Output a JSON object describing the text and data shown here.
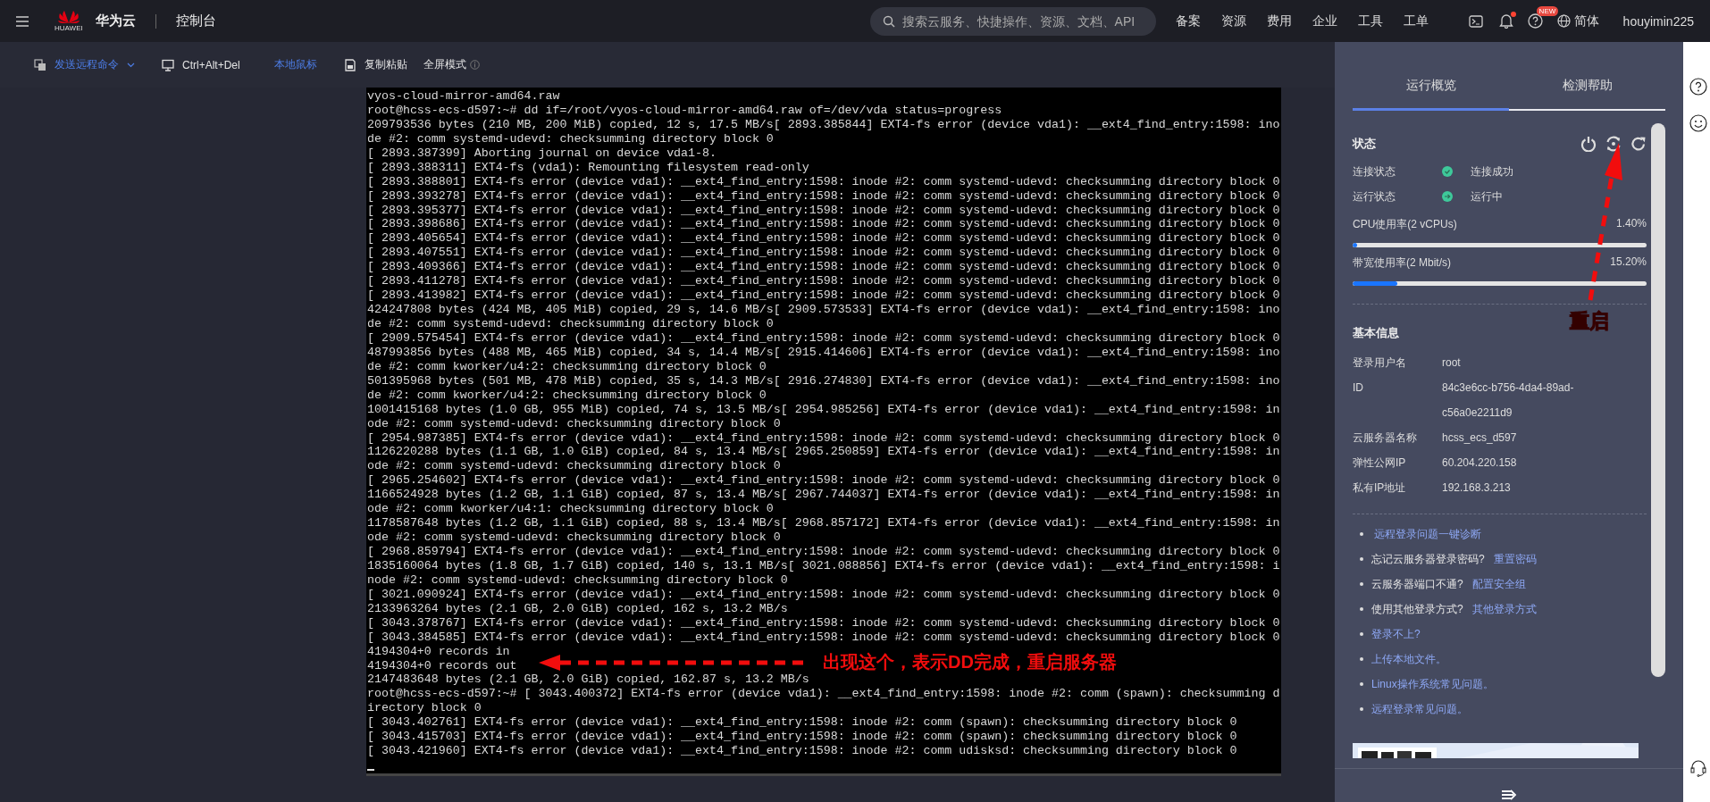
{
  "header": {
    "logo_text": "HUAWEI",
    "brand": "华为云",
    "console": "控制台",
    "search": {
      "placeholder": "搜索云服务、快捷操作、资源、文档、API"
    },
    "nav": [
      "备案",
      "资源",
      "费用",
      "企业",
      "工具",
      "工单"
    ],
    "bell_dot": true,
    "help_badge": "NEW",
    "language": "简体",
    "user": "houyimin225"
  },
  "toolbar": [
    {
      "label": "发送远程命令",
      "highlighted": true,
      "dropdown": true
    },
    {
      "label": "Ctrl+Alt+Del",
      "highlighted": false,
      "dropdown": false
    },
    {
      "label": "本地鼠标",
      "highlighted": true,
      "dropdown": false
    },
    {
      "label": "复制粘贴",
      "highlighted": false,
      "dropdown": false
    },
    {
      "label": "全屏模式",
      "highlighted": false,
      "dropdown": false
    }
  ],
  "terminal": {
    "lines": [
      "vyos-cloud-mirror-amd64.raw",
      "root@hcss-ecs-d597:~# dd if=/root/vyos-cloud-mirror-amd64.raw of=/dev/vda status=progress",
      "209793536 bytes (210 MB, 200 MiB) copied, 12 s, 17.5 MB/s[ 2893.385844] EXT4-fs error (device vda1): __ext4_find_entry:1598: ino",
      "de #2: comm systemd-udevd: checksumming directory block 0",
      "[ 2893.387399] Aborting journal on device vda1-8.",
      "[ 2893.388311] EXT4-fs (vda1): Remounting filesystem read-only",
      "[ 2893.388801] EXT4-fs error (device vda1): __ext4_find_entry:1598: inode #2: comm systemd-udevd: checksumming directory block 0",
      "[ 2893.393278] EXT4-fs error (device vda1): __ext4_find_entry:1598: inode #2: comm systemd-udevd: checksumming directory block 0",
      "[ 2893.395377] EXT4-fs error (device vda1): __ext4_find_entry:1598: inode #2: comm systemd-udevd: checksumming directory block 0",
      "[ 2893.398686] EXT4-fs error (device vda1): __ext4_find_entry:1598: inode #2: comm systemd-udevd: checksumming directory block 0",
      "[ 2893.405654] EXT4-fs error (device vda1): __ext4_find_entry:1598: inode #2: comm systemd-udevd: checksumming directory block 0",
      "[ 2893.407551] EXT4-fs error (device vda1): __ext4_find_entry:1598: inode #2: comm systemd-udevd: checksumming directory block 0",
      "[ 2893.409366] EXT4-fs error (device vda1): __ext4_find_entry:1598: inode #2: comm systemd-udevd: checksumming directory block 0",
      "[ 2893.411278] EXT4-fs error (device vda1): __ext4_find_entry:1598: inode #2: comm systemd-udevd: checksumming directory block 0",
      "[ 2893.413982] EXT4-fs error (device vda1): __ext4_find_entry:1598: inode #2: comm systemd-udevd: checksumming directory block 0",
      "424247808 bytes (424 MB, 405 MiB) copied, 29 s, 14.6 MB/s[ 2909.573533] EXT4-fs error (device vda1): __ext4_find_entry:1598: ino",
      "de #2: comm systemd-udevd: checksumming directory block 0",
      "[ 2909.575454] EXT4-fs error (device vda1): __ext4_find_entry:1598: inode #2: comm systemd-udevd: checksumming directory block 0",
      "487993856 bytes (488 MB, 465 MiB) copied, 34 s, 14.4 MB/s[ 2915.414606] EXT4-fs error (device vda1): __ext4_find_entry:1598: ino",
      "de #2: comm kworker/u4:2: checksumming directory block 0",
      "501395968 bytes (501 MB, 478 MiB) copied, 35 s, 14.3 MB/s[ 2916.274830] EXT4-fs error (device vda1): __ext4_find_entry:1598: ino",
      "de #2: comm kworker/u4:2: checksumming directory block 0",
      "1001415168 bytes (1.0 GB, 955 MiB) copied, 74 s, 13.5 MB/s[ 2954.985256] EXT4-fs error (device vda1): __ext4_find_entry:1598: in",
      "ode #2: comm systemd-udevd: checksumming directory block 0",
      "[ 2954.987385] EXT4-fs error (device vda1): __ext4_find_entry:1598: inode #2: comm systemd-udevd: checksumming directory block 0",
      "1126220288 bytes (1.1 GB, 1.0 GiB) copied, 84 s, 13.4 MB/s[ 2965.250859] EXT4-fs error (device vda1): __ext4_find_entry:1598: in",
      "ode #2: comm systemd-udevd: checksumming directory block 0",
      "[ 2965.254602] EXT4-fs error (device vda1): __ext4_find_entry:1598: inode #2: comm systemd-udevd: checksumming directory block 0",
      "1166524928 bytes (1.2 GB, 1.1 GiB) copied, 87 s, 13.4 MB/s[ 2967.744037] EXT4-fs error (device vda1): __ext4_find_entry:1598: in",
      "ode #2: comm kworker/u4:1: checksumming directory block 0",
      "1178587648 bytes (1.2 GB, 1.1 GiB) copied, 88 s, 13.4 MB/s[ 2968.857172] EXT4-fs error (device vda1): __ext4_find_entry:1598: in",
      "ode #2: comm systemd-udevd: checksumming directory block 0",
      "[ 2968.859794] EXT4-fs error (device vda1): __ext4_find_entry:1598: inode #2: comm systemd-udevd: checksumming directory block 0",
      "1835160064 bytes (1.8 GB, 1.7 GiB) copied, 140 s, 13.1 MB/s[ 3021.088856] EXT4-fs error (device vda1): __ext4_find_entry:1598: i",
      "node #2: comm systemd-udevd: checksumming directory block 0",
      "[ 3021.090924] EXT4-fs error (device vda1): __ext4_find_entry:1598: inode #2: comm systemd-udevd: checksumming directory block 0",
      "2133963264 bytes (2.1 GB, 2.0 GiB) copied, 162 s, 13.2 MB/s",
      "[ 3043.378767] EXT4-fs error (device vda1): __ext4_find_entry:1598: inode #2: comm systemd-udevd: checksumming directory block 0",
      "[ 3043.384585] EXT4-fs error (device vda1): __ext4_find_entry:1598: inode #2: comm systemd-udevd: checksumming directory block 0",
      "4194304+0 records in",
      "4194304+0 records out",
      "2147483648 bytes (2.1 GB, 2.0 GiB) copied, 162.87 s, 13.2 MB/s",
      "root@hcss-ecs-d597:~# [ 3043.400372] EXT4-fs error (device vda1): __ext4_find_entry:1598: inode #2: comm (spawn): checksumming d",
      "irectory block 0",
      "[ 3043.402761] EXT4-fs error (device vda1): __ext4_find_entry:1598: inode #2: comm (spawn): checksumming directory block 0",
      "[ 3043.415703] EXT4-fs error (device vda1): __ext4_find_entry:1598: inode #2: comm (spawn): checksumming directory block 0",
      "[ 3043.421960] EXT4-fs error (device vda1): __ext4_find_entry:1598: inode #2: comm udisksd: checksumming directory block 0"
    ],
    "cursor": true
  },
  "panel": {
    "tabs": [
      {
        "label": "运行概览",
        "selected": true
      },
      {
        "label": "检测帮助",
        "selected": false
      }
    ],
    "status": {
      "title": "状态",
      "rows": [
        {
          "label": "连接状态",
          "value": "连接成功",
          "kind": "ok"
        },
        {
          "label": "运行状态",
          "value": "运行中",
          "kind": "running"
        }
      ],
      "meters": [
        {
          "label": "CPU使用率(2 vCPUs)",
          "reading": "1.40%",
          "level": 0.014
        },
        {
          "label": "带宽使用率(2 Mbit/s)",
          "reading": "15.20%",
          "level": 0.152
        }
      ]
    },
    "basic_info": {
      "title": "基本信息",
      "rows": [
        {
          "label": "登录用户名",
          "value": "root"
        },
        {
          "label": "ID",
          "value": "84c3e6cc-b756-4da4-89ad-c56a0e2211d9"
        },
        {
          "label": "云服务器名称",
          "value": "hcss_ecs_d597"
        },
        {
          "label": "弹性公网IP",
          "value": "60.204.220.158"
        },
        {
          "label": "私有IP地址",
          "value": "192.168.3.213"
        }
      ]
    },
    "help_links": [
      {
        "link": "远程登录问题一键诊断"
      },
      {
        "text": "忘记云服务器登录密码?",
        "link": "重置密码"
      },
      {
        "text": "云服务器端口不通?",
        "link": "配置安全组"
      },
      {
        "text": "使用其他登录方式?",
        "link": "其他登录方式"
      },
      {
        "link": "登录不上?"
      },
      {
        "link": "上传本地文件。"
      },
      {
        "link": "Linux操作系统常见问题。"
      },
      {
        "link": "远程登录常见问题。"
      }
    ]
  },
  "annotations": [
    {
      "kind": "terminal",
      "text": "出现这个，表示DD完成，重启服务器"
    },
    {
      "kind": "panel",
      "text": "重启"
    }
  ]
}
